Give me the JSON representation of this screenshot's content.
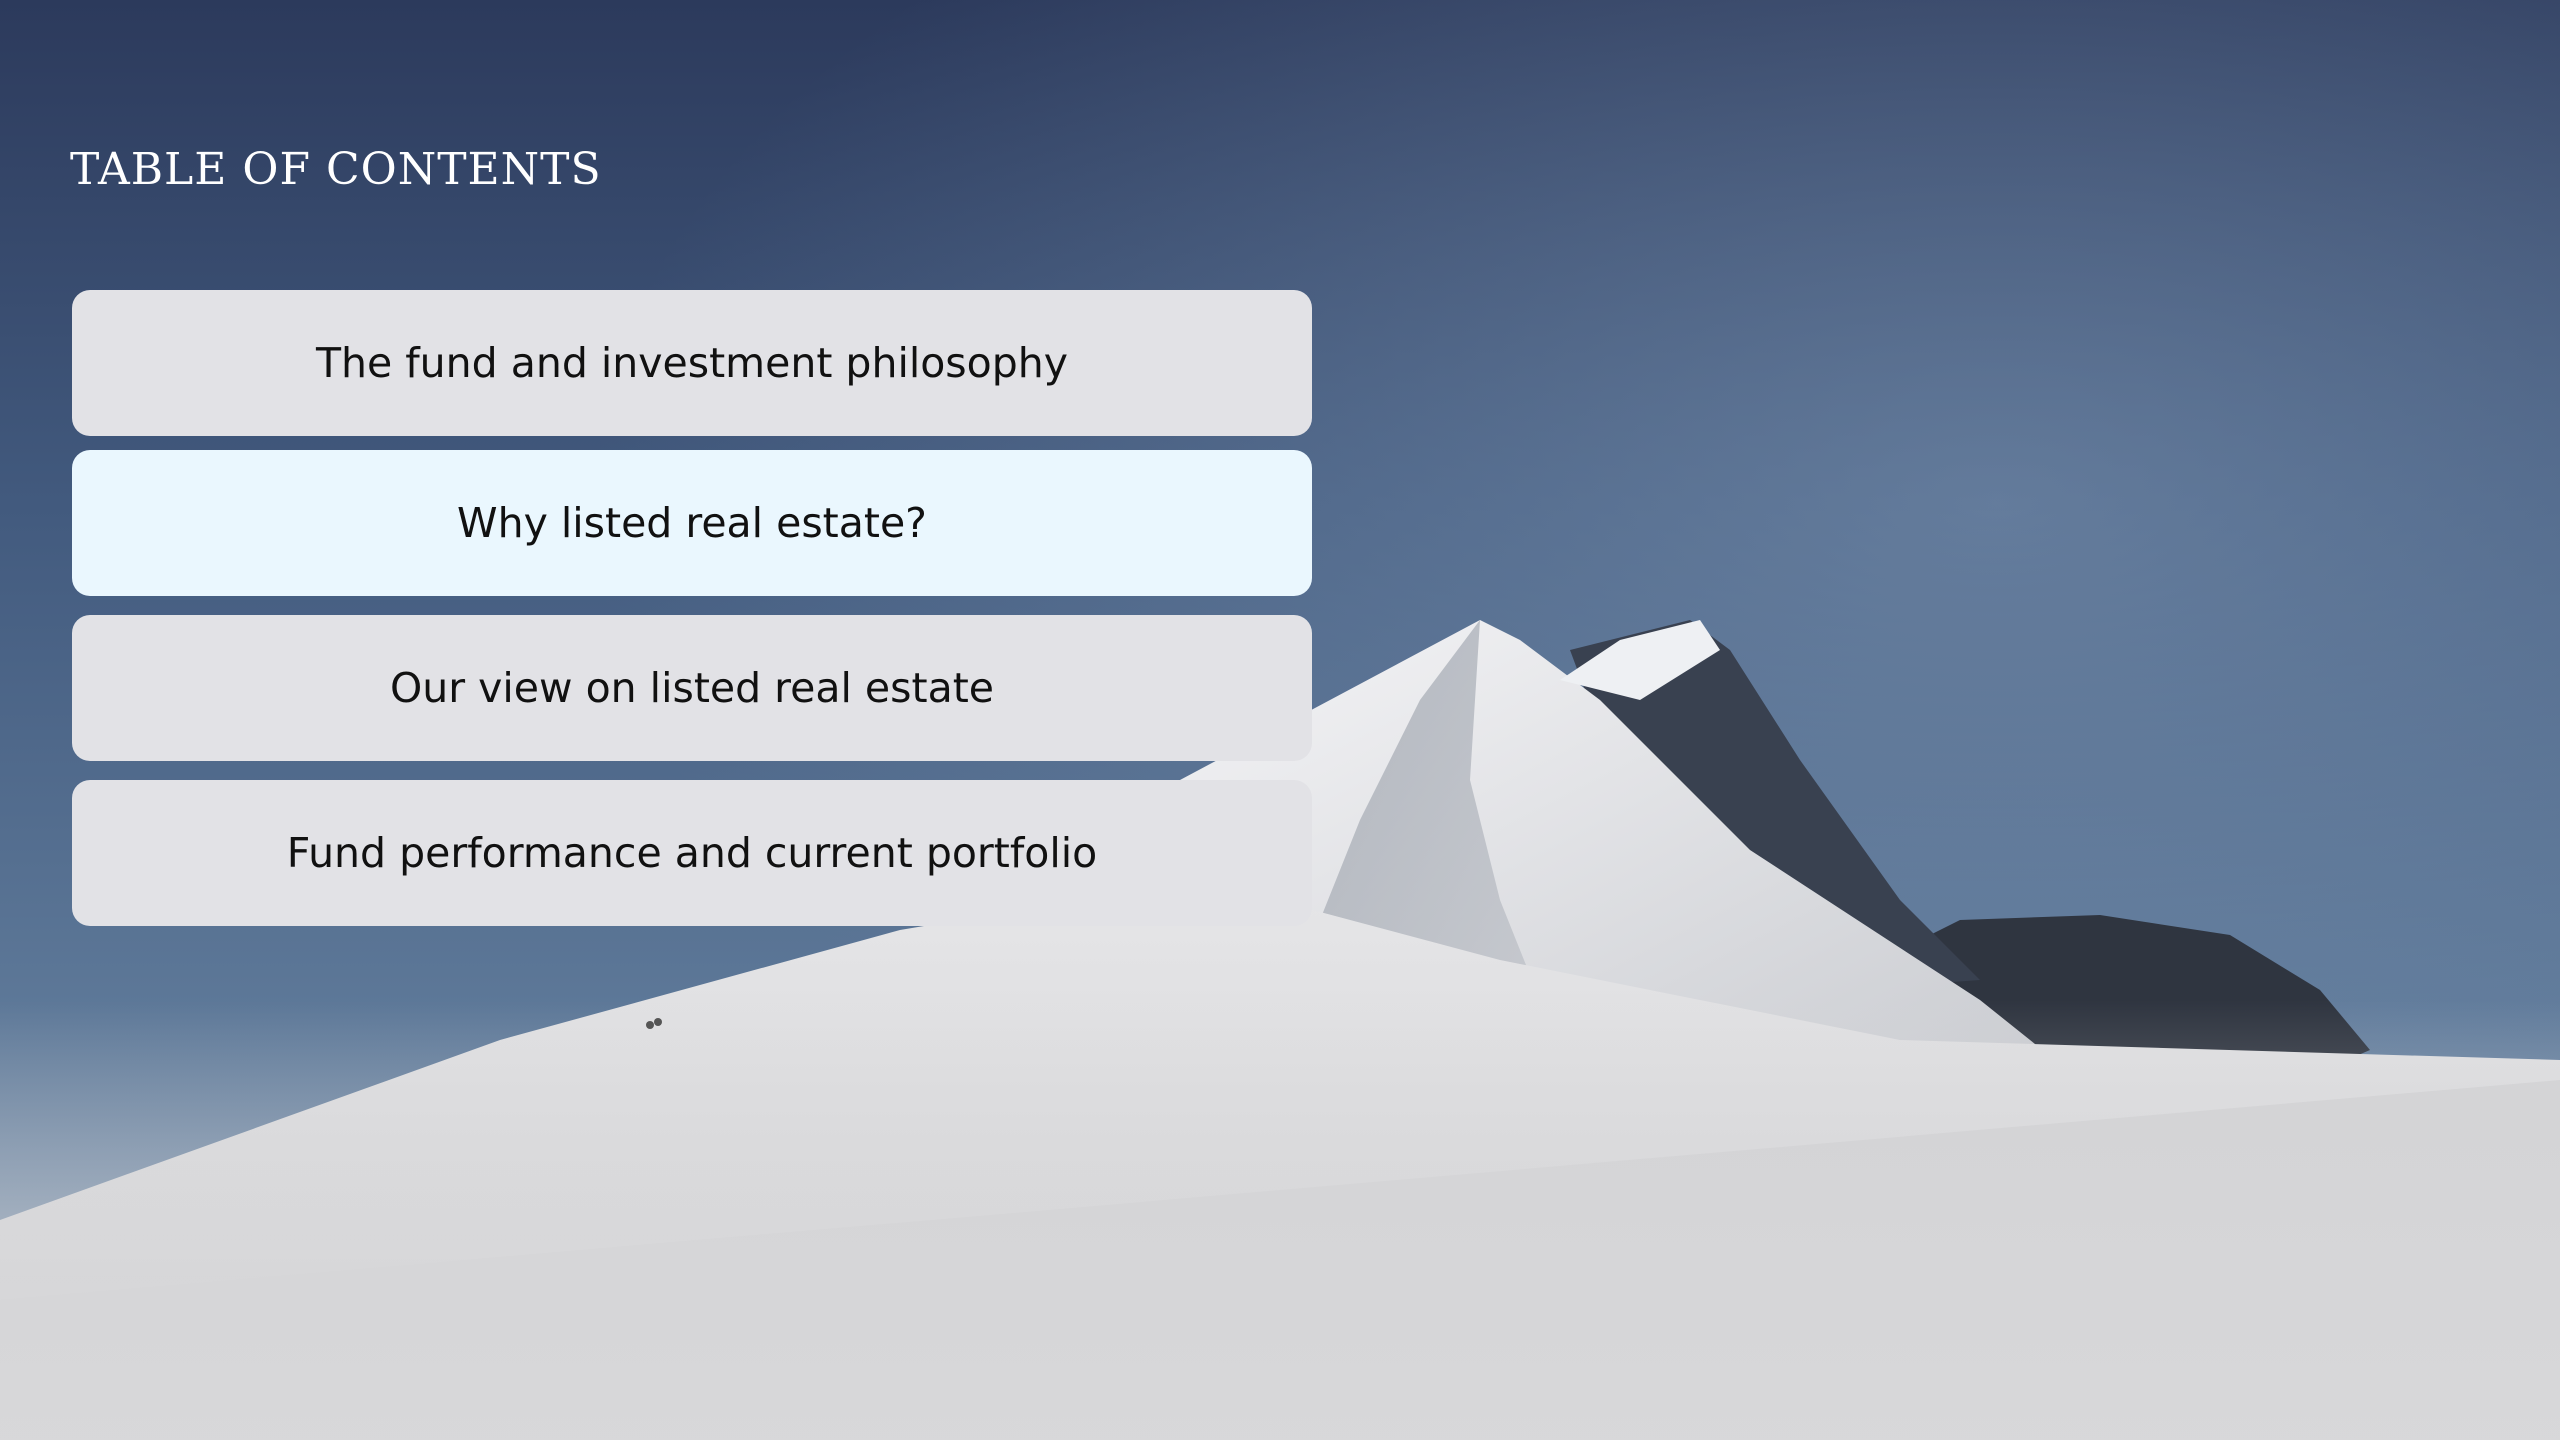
{
  "slide": {
    "title": "TABLE OF CONTENTS"
  },
  "toc": {
    "items": [
      {
        "label": "The fund and investment philosophy",
        "active": false
      },
      {
        "label": "Why listed real estate?",
        "active": true
      },
      {
        "label": "Our view on listed real estate",
        "active": false
      },
      {
        "label": "Fund performance and current portfolio",
        "active": false
      }
    ]
  },
  "colors": {
    "sky_top": "#2c3a5c",
    "sky_mid": "#4f6a8e",
    "snow": "#d4d4d6",
    "rock": "#2f3540",
    "item_bg": "#e2e2e6",
    "item_active_bg": "#eaf7fe",
    "title_text": "#ffffff",
    "item_text": "#111111"
  }
}
